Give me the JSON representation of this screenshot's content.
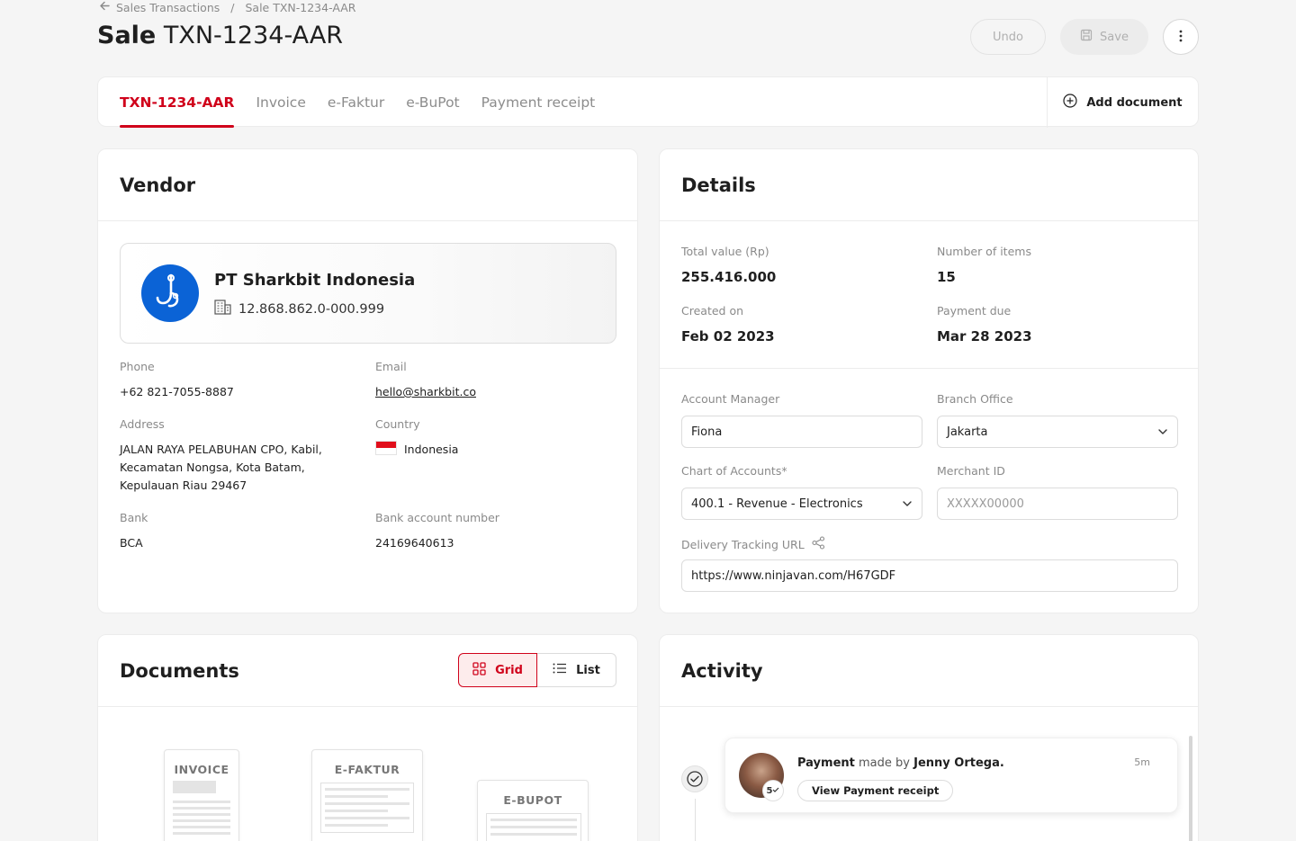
{
  "breadcrumb": {
    "parent": "Sales Transactions",
    "separator": "/",
    "current": "Sale TXN-1234-AAR"
  },
  "header": {
    "title_bold": "Sale",
    "title_id": "TXN-1234-AAR",
    "undo_label": "Undo",
    "save_label": "Save"
  },
  "tabs": [
    {
      "label": "TXN-1234-AAR",
      "active": true
    },
    {
      "label": "Invoice"
    },
    {
      "label": "e-Faktur"
    },
    {
      "label": "e-BuPot"
    },
    {
      "label": "Payment receipt"
    }
  ],
  "add_document_label": "Add document",
  "vendor": {
    "heading": "Vendor",
    "name": "PT Sharkbit Indonesia",
    "npwp": "12.868.862.0-000.999",
    "phone_label": "Phone",
    "phone": "+62 821-7055-8887",
    "email_label": "Email",
    "email": "hello@sharkbit.co",
    "address_label": "Address",
    "address_line1": "JALAN RAYA PELABUHAN CPO, Kabil,",
    "address_line2": "Kecamatan Nongsa, Kota Batam,",
    "address_line3": "Kepulauan Riau 29467",
    "country_label": "Country",
    "country": "Indonesia",
    "bank_label": "Bank",
    "bank": "BCA",
    "account_label": "Bank account number",
    "account": "24169640613"
  },
  "details": {
    "heading": "Details",
    "total_label": "Total value (Rp)",
    "total": "255.416.000",
    "items_label": "Number of items",
    "items": "15",
    "created_label": "Created on",
    "created": "Feb 02 2023",
    "due_label": "Payment due",
    "due": "Mar 28 2023",
    "manager_label": "Account Manager",
    "manager": "Fiona",
    "branch_label": "Branch Office",
    "branch": "Jakarta",
    "coa_label": "Chart of Accounts*",
    "coa": "400.1 - Revenue - Electronics",
    "merchant_label": "Merchant ID",
    "merchant_placeholder": "XXXXX00000",
    "tracking_label": "Delivery Tracking URL",
    "tracking": "https://www.ninjavan.com/H67GDF"
  },
  "documents": {
    "heading": "Documents",
    "grid_label": "Grid",
    "list_label": "List",
    "thumbs": [
      {
        "title": "INVOICE"
      },
      {
        "title": "E-FAKTUR"
      },
      {
        "title": "E-BUPOT"
      }
    ]
  },
  "activity": {
    "heading": "Activity",
    "item": {
      "type": "Payment",
      "made_by": "made by",
      "person": "Jenny Ortega.",
      "time": "5m",
      "button": "View Payment receipt",
      "badge": "5"
    }
  },
  "colors": {
    "accent": "#d0021b",
    "vendor_logo": "#0b63d6"
  }
}
